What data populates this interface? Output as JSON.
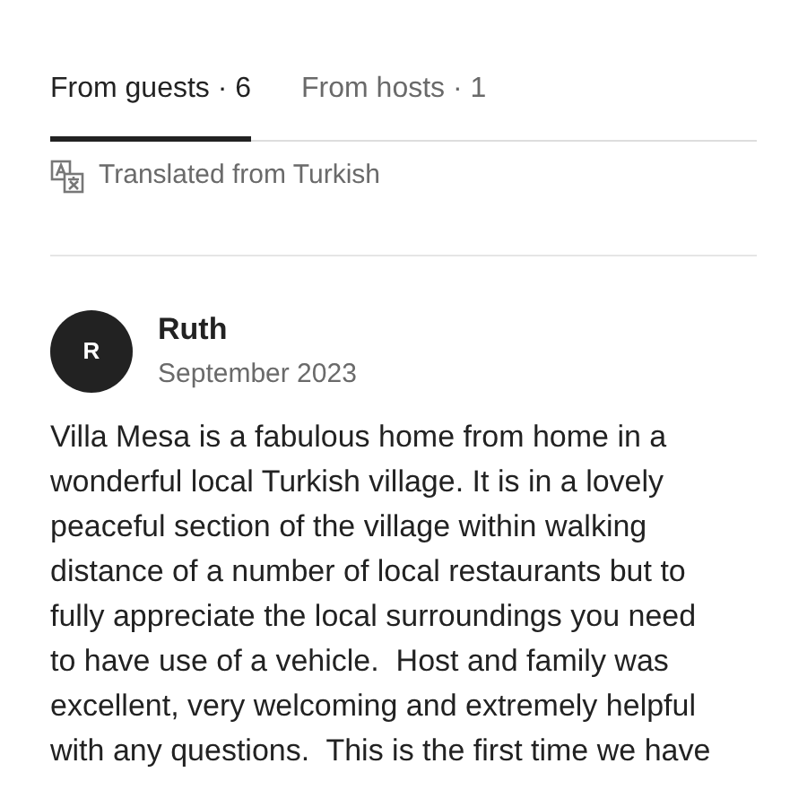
{
  "tabs": [
    {
      "label": "From guests · 6",
      "selected": true
    },
    {
      "label": "From hosts · 1",
      "selected": false
    }
  ],
  "translation_note": "Translated from Turkish",
  "review": {
    "avatar_initial": "R",
    "name": "Ruth",
    "date": "September 2023",
    "body_lines": [
      "Villa Mesa is a fabulous home from home in a",
      "wonderful local Turkish village. It is in a lovely",
      "peaceful section of the village within walking",
      "distance of a number of local restaurants but to",
      "fully appreciate the local surroundings you need",
      "to have use of a vehicle.  Host and family was",
      "excellent, very welcoming and extremely helpful",
      "with any questions.  This is the first time we have"
    ]
  }
}
